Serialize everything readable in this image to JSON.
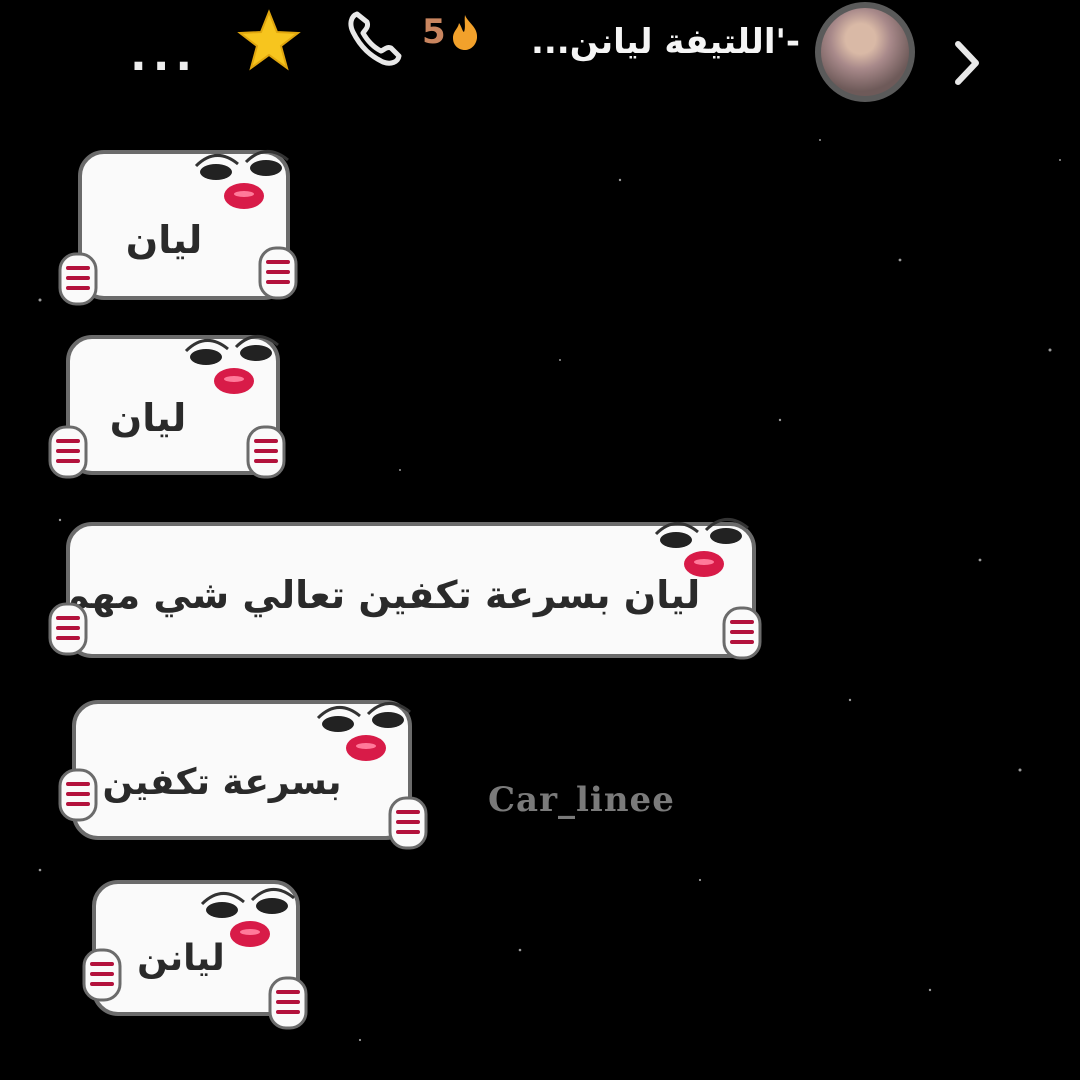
{
  "header": {
    "more_label": "...",
    "streak_count": "5",
    "title": "-'اللتيفة ليانن...",
    "star_icon": "star-icon",
    "call_icon": "phone-icon",
    "fire_icon": "fire-icon",
    "back_icon": "chevron-right-icon"
  },
  "messages": [
    {
      "text": "ليان"
    },
    {
      "text": "ليان"
    },
    {
      "text": "ليان بسرعة تكفين تعالي شي مهم"
    },
    {
      "text": "بسرعة تكفين"
    },
    {
      "text": "ليانن"
    }
  ],
  "watermark": "Car_linee",
  "colors": {
    "background": "#000000",
    "star": "#f7c51e",
    "lips": "#d81b48",
    "streak": "#c9855f"
  }
}
